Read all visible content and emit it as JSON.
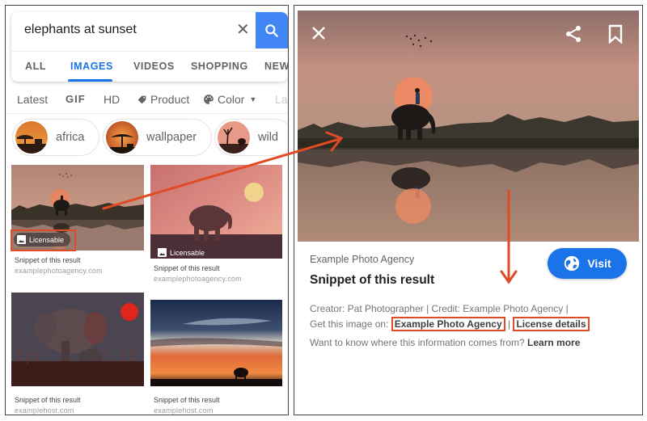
{
  "search": {
    "query": "elephants at sunset",
    "clear_icon": "close-icon",
    "search_icon": "search-icon"
  },
  "tabs": [
    {
      "label": "ALL",
      "active": false
    },
    {
      "label": "IMAGES",
      "active": true
    },
    {
      "label": "VIDEOS",
      "active": false
    },
    {
      "label": "SHOPPING",
      "active": false
    },
    {
      "label": "NEWS",
      "active": false
    }
  ],
  "filters": [
    {
      "label": "Latest"
    },
    {
      "label": "GIF"
    },
    {
      "label": "HD"
    },
    {
      "label": "Product",
      "icon": "tag-icon"
    },
    {
      "label": "Color",
      "icon": "palette-icon",
      "dropdown": true
    },
    {
      "label": "La"
    }
  ],
  "chips": [
    {
      "label": "africa"
    },
    {
      "label": "wallpaper"
    },
    {
      "label": "wild"
    }
  ],
  "results": [
    {
      "snippet": "Snippet of this result",
      "host": "examplephotoagency.com",
      "badge": "Licensable",
      "highlighted": true
    },
    {
      "snippet": "Snippet of this result",
      "host": "examplephotoagency.com",
      "badge": "Licensable",
      "highlighted": false
    },
    {
      "snippet": "Snippet of this result",
      "host": "examplehost.com"
    },
    {
      "snippet": "Snippet of this result",
      "host": "examplehost.com"
    }
  ],
  "detail": {
    "close_icon": "close-icon",
    "share_icon": "share-icon",
    "bookmark_icon": "bookmark-icon",
    "agency": "Example Photo Agency",
    "title": "Snippet of this result",
    "visit_label": "Visit",
    "creator_line": "Creator: Pat Photographer | Credit: Example Photo Agency |",
    "get_prefix": "Get this image on:",
    "get_link": "Example Photo Agency",
    "separator": "|",
    "license_link": "License details",
    "info_prefix": "Want to know where this information comes from?",
    "learn_more": "Learn more"
  },
  "colors": {
    "accent": "#1a73e8",
    "search_button": "#4285f4",
    "highlight": "#e04a24"
  }
}
